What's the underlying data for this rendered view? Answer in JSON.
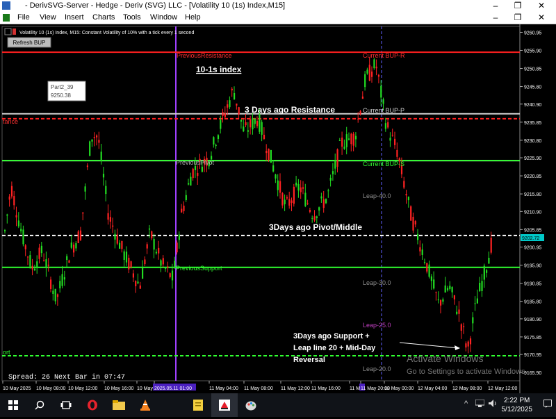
{
  "window": {
    "title": "- DerivSVG-Server - Hedge - Deriv (SVG) LLC - [Volatility 10 (1s) Index,M15]",
    "minimize": "–",
    "restore": "❐",
    "close": "✕"
  },
  "menu": {
    "items": [
      "File",
      "View",
      "Insert",
      "Charts",
      "Tools",
      "Window",
      "Help"
    ],
    "mdi_min": "–",
    "mdi_restore": "❐",
    "mdi_close": "✕"
  },
  "chart": {
    "header": "Volatility 10 (1s) Index, M15:  Constant Volatility of 10% with a tick every 1 second",
    "refresh_button": "Refresh BUP",
    "tooltip_line1": "Part2_39",
    "tooltip_line2": "9250.38",
    "spread_text": "Spread: 26  Next Bar in 07:47",
    "current_price": "9202.72",
    "watermark_line1": "Activate Windows",
    "watermark_line2": "Go to Settings to activate Windows.",
    "price_ticks": [
      "9260.95",
      "9255.90",
      "9250.85",
      "9245.80",
      "9240.90",
      "9235.85",
      "9230.80",
      "9225.90",
      "9220.85",
      "9215.80",
      "9210.90",
      "9205.85",
      "9200.95",
      "9195.90",
      "9190.85",
      "9185.80",
      "9180.90",
      "9175.85",
      "9170.95",
      "9165.90"
    ],
    "time_ticks": [
      "10 May 2025",
      "10 May 08:00",
      "10 May 12:00",
      "10 May 16:00",
      "10 May 20:00",
      "2025.05.11 01:00",
      "11 May 04:00",
      "11 May 08:00",
      "11 May 12:00",
      "11 May 16:00",
      "11 M",
      "11 May 20:00",
      "12 May 00:00",
      "12 May 04:00",
      "12 May 08:00",
      "12 May 12:00"
    ],
    "lines": [
      {
        "label": "PreviousResistance",
        "price": 9255.4,
        "color": "#ff2020",
        "style": "solid"
      },
      {
        "label": "Current BUP-R",
        "price": 9255.4,
        "color": "#ff2020",
        "style": "solid"
      },
      {
        "label": "3 Days ago Resistance",
        "price": 9236.8,
        "color": "#ff2020",
        "style": "dashed"
      },
      {
        "label": "tance",
        "price": 9236.8,
        "color": "#ff2020",
        "style": "dashed"
      },
      {
        "label": "Current BUP-P",
        "price": 9238.2,
        "color": "#d0d0d0",
        "style": "solid"
      },
      {
        "label": "PreviousPivot",
        "price": 9225.1,
        "color": "#d0d0d0",
        "style": "solid"
      },
      {
        "label": "Current BUP-S",
        "price": 9225.1,
        "color": "#30ff30",
        "style": "solid"
      },
      {
        "label": "Leap-40.0",
        "price": 9217.8,
        "color": "#808080",
        "style": "none"
      },
      {
        "label": "3Days ago Pivot/Middle",
        "price": 9204.2,
        "color": "#ffffff",
        "style": "dashed"
      },
      {
        "label": "PreviousSupport",
        "price": 9195.3,
        "color": "#30ff30",
        "style": "solid"
      },
      {
        "label": "Leap-30.0",
        "price": 9189.0,
        "color": "#808080",
        "style": "none"
      },
      {
        "label": "Leap-25.0",
        "price": 9177.6,
        "color": "#c040c0",
        "style": "none"
      },
      {
        "label": "3Days ago Support + Leap line 20 + Mid-Day Reversal",
        "price": 9170.6,
        "color": "#30ff30",
        "style": "dashed"
      },
      {
        "label": "ort",
        "price": 9170.6,
        "color": "#30ff30",
        "style": "dashed"
      },
      {
        "label": "Leap-20.0",
        "price": 9166.0,
        "color": "#808080",
        "style": "none"
      }
    ],
    "index_title": "10-1s index",
    "annotation_support_lines": [
      "3Days ago Support +",
      "Leap line 20 + Mid-Day",
      "Reversal"
    ]
  },
  "taskbar": {
    "time": "2:22 PM",
    "date": "5/12/2025",
    "icons": [
      "windows-logo",
      "search",
      "task-view",
      "opera",
      "file-explorer",
      "vlc",
      "notepad",
      "deriv-mt5",
      "paint"
    ]
  }
}
